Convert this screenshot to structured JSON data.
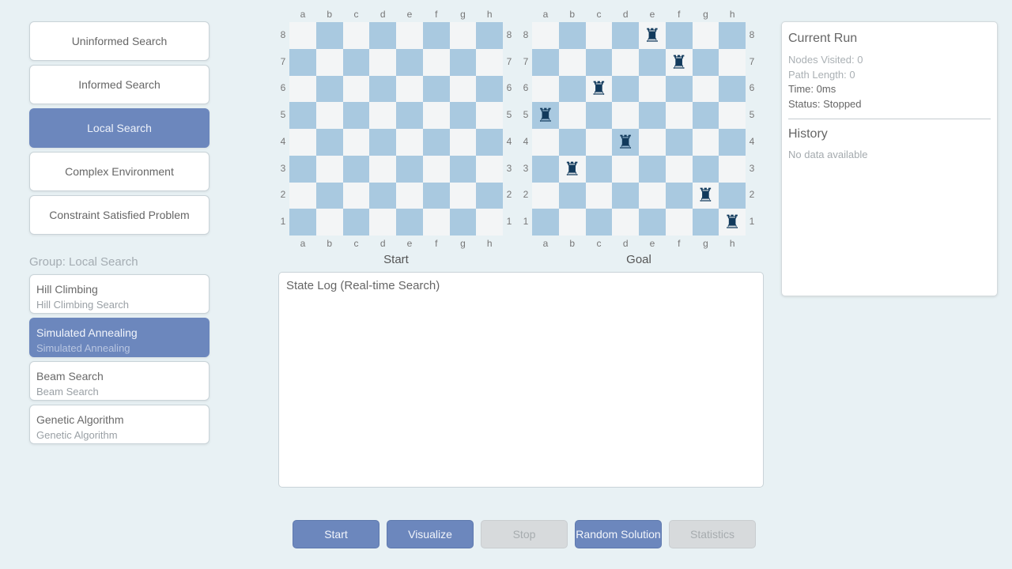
{
  "categories": [
    {
      "label": "Uninformed Search",
      "active": false
    },
    {
      "label": "Informed Search",
      "active": false
    },
    {
      "label": "Local Search",
      "active": true
    },
    {
      "label": "Complex Environment",
      "active": false
    },
    {
      "label": "Constraint Satisfied Problem",
      "active": false
    }
  ],
  "group": {
    "label": "Group: Local Search"
  },
  "algorithms": [
    {
      "title": "Hill Climbing",
      "subtitle": "Hill Climbing Search",
      "active": false
    },
    {
      "title": "Simulated Annealing",
      "subtitle": "Simulated Annealing",
      "active": true
    },
    {
      "title": "Beam Search",
      "subtitle": "Beam Search",
      "active": false
    },
    {
      "title": "Genetic Algorithm",
      "subtitle": "Genetic Algorithm",
      "active": false
    }
  ],
  "boards": {
    "files": [
      "a",
      "b",
      "c",
      "d",
      "e",
      "f",
      "g",
      "h"
    ],
    "ranks": [
      "8",
      "7",
      "6",
      "5",
      "4",
      "3",
      "2",
      "1"
    ],
    "start": {
      "caption": "Start",
      "pieces": []
    },
    "goal": {
      "caption": "Goal",
      "piece_glyph": "♜",
      "pieces": [
        "e8",
        "f7",
        "c6",
        "a5",
        "d4",
        "b3",
        "g2",
        "h1"
      ]
    }
  },
  "log": {
    "title": "State Log (Real-time Search)"
  },
  "current_run": {
    "title": "Current Run",
    "nodes_visited": "Nodes Visited: 0",
    "path_length": "Path Length: 0",
    "time": "Time: 0ms",
    "status": "Status: Stopped"
  },
  "history": {
    "title": "History",
    "empty": "No data available"
  },
  "controls": [
    {
      "label": "Start",
      "enabled": true
    },
    {
      "label": "Visualize",
      "enabled": true
    },
    {
      "label": "Stop",
      "enabled": false
    },
    {
      "label": "Random Solution",
      "enabled": true
    },
    {
      "label": "Statistics",
      "enabled": false
    }
  ],
  "colors": {
    "accent": "#6c87bd",
    "board_dark": "#a9c9e0",
    "board_light": "#f3f5f6",
    "piece": "#123a5c"
  }
}
